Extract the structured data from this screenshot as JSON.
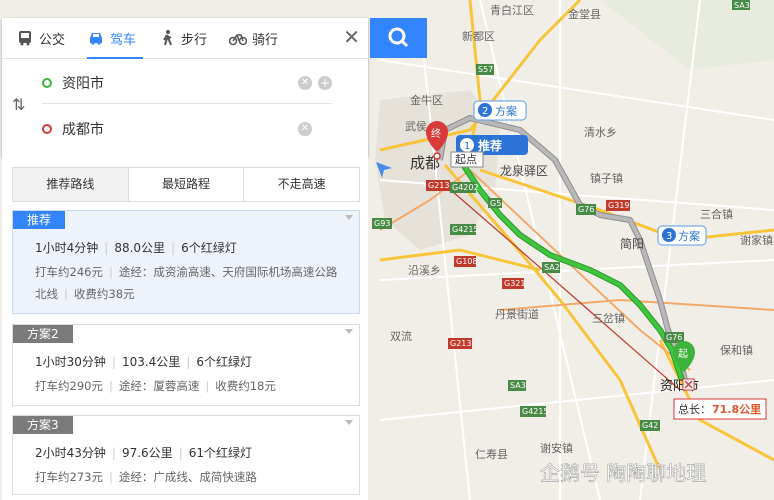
{
  "modes": [
    {
      "label": "公交",
      "icon": "bus-icon"
    },
    {
      "label": "驾车",
      "icon": "car-icon"
    },
    {
      "label": "步行",
      "icon": "walk-icon"
    },
    {
      "label": "骑行",
      "icon": "bike-icon"
    }
  ],
  "active_mode": "驾车",
  "start": {
    "value": "资阳市"
  },
  "end": {
    "value": "成都市"
  },
  "tabs": [
    "推荐路线",
    "最短路程",
    "不走高速"
  ],
  "routes": [
    {
      "label": "推荐",
      "time": "1小时4分钟",
      "distance": "88.0公里",
      "lights": "6个红绿灯",
      "taxi": "打车约246元",
      "via": "途经：成资渝高速、天府国际机场高速公路北线",
      "toll": "收费约38元"
    },
    {
      "label": "方案2",
      "time": "1小时30分钟",
      "distance": "103.4公里",
      "lights": "6个红绿灯",
      "taxi": "打车约290元",
      "via": "途经：厦蓉高速",
      "toll": "收费约18元"
    },
    {
      "label": "方案3",
      "time": "2小时43分钟",
      "distance": "97.6公里",
      "lights": "61个红绿灯",
      "taxi": "打车约273元",
      "via": "途经：广成线、成简快速路",
      "toll": ""
    }
  ],
  "map": {
    "places": [
      "青白江区",
      "金堂县",
      "新都区",
      "金牛区",
      "武侯",
      "成都",
      "龙泉驿区",
      "清水乡",
      "沿溪乡",
      "丹景街道",
      "简阳",
      "三合镇",
      "资阳市",
      "保和镇",
      "仁寿县",
      "谢家镇",
      "谢安镇",
      "镇子镇",
      "三岔镇",
      "双流"
    ],
    "roads": [
      "G5",
      "G213",
      "G4202",
      "G93",
      "G4215",
      "G108",
      "SA2",
      "G321",
      "G213",
      "G76",
      "G319",
      "SA3",
      "G4215",
      "G76",
      "S57",
      "G42",
      "SA3"
    ],
    "markers": {
      "end": "终",
      "start": "起",
      "start_label": "起点"
    },
    "route_tags": [
      {
        "num": "1",
        "text": "推荐"
      },
      {
        "num": "2",
        "text": "方案"
      },
      {
        "num": "3",
        "text": "方案"
      }
    ],
    "total_label": "总长：",
    "total_value": "71.8公里",
    "watermark": "企鹅号 陶陶聊地理"
  },
  "colors": {
    "accent": "#3385ff",
    "recommend_route": "#2db52d",
    "alt_route": "#9a9a9a",
    "highway": "#4a8a47",
    "national_road": "#c0392b"
  }
}
